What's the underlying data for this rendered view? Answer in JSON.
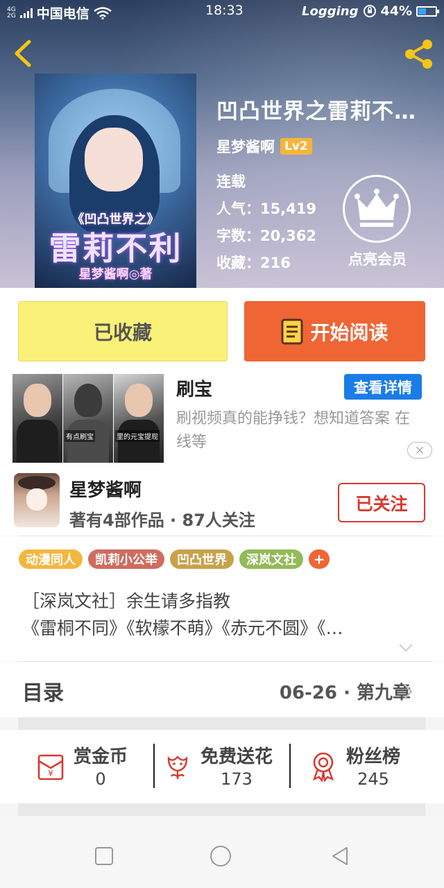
{
  "status_bar": {
    "network_type_top": "4G",
    "network_type_bottom": "2G",
    "carrier": "中国电信",
    "time": "18:33",
    "logging": "Logging",
    "battery_percent": "44%",
    "battery_level": 0.44
  },
  "header": {
    "back_icon": "chevron-left-icon",
    "share_icon": "share-icon",
    "cover": {
      "subtitle": "《凹凸世界之》",
      "title": "雷莉不利",
      "author": "星梦酱啊◎著"
    },
    "book_title": "凹凸世界之雷莉不…",
    "author_name": "星梦酱啊",
    "author_level": "Lv2",
    "status": "连载",
    "popularity": "人气：15,419",
    "word_count": "字数：20,362",
    "favorites": "收藏：216",
    "vip_icon": "crown-icon",
    "vip_label": "点亮会员"
  },
  "actions": {
    "collect_label": "已收藏",
    "read_label": "开始阅读",
    "read_icon": "book-icon",
    "collect_color": "#faf178",
    "read_color": "#ef6534"
  },
  "ad": {
    "title": "刷宝",
    "detail_button": "查看详情",
    "description": "刷视频真的能挣钱？想知道答案 在线等",
    "thumb_captions": [
      "有点刷宝",
      "里的元宝提现"
    ],
    "close_icon": "close-icon"
  },
  "author": {
    "name": "星梦酱啊",
    "info": "著有4部作品 · 87人关注",
    "follow_label": "已关注"
  },
  "tags": [
    {
      "label": "动漫同人",
      "color": "#f5b63f"
    },
    {
      "label": "凯莉小公举",
      "color": "#cf6c5f"
    },
    {
      "label": "凹凸世界",
      "color": "#c9a14b"
    },
    {
      "label": "深岚文社",
      "color": "#93ba58"
    }
  ],
  "tag_add": "+",
  "intro": {
    "line1": "［深岚文社］余生请多指教",
    "line2": "《雷桐不同》《软檬不萌》《赤元不圆》《…"
  },
  "catalog": {
    "title": "目录",
    "latest": "06-26 · 第九章"
  },
  "stats": [
    {
      "label": "赏金币",
      "value": "0",
      "icon": "red-envelope-icon"
    },
    {
      "label": "免费送花",
      "value": "173",
      "icon": "flower-icon"
    },
    {
      "label": "粉丝榜",
      "value": "245",
      "icon": "medal-icon"
    }
  ],
  "navbar": [
    "square-icon",
    "circle-icon",
    "triangle-back-icon"
  ]
}
